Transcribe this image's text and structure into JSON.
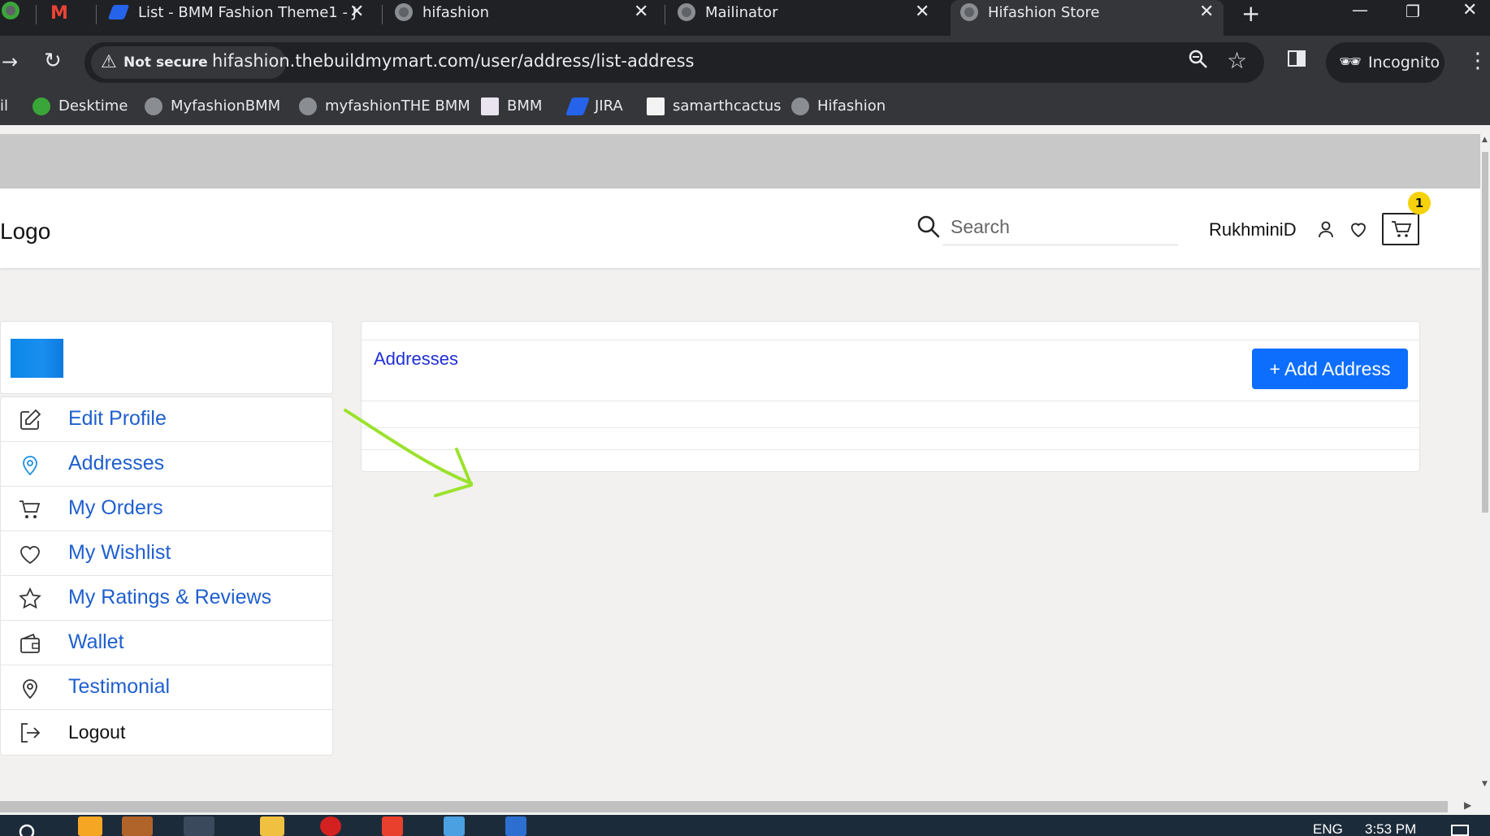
{
  "browser": {
    "tabs": [
      {
        "title": "List - BMM Fashion Theme1 - J",
        "close": "✕",
        "active": false
      },
      {
        "title": "hifashion",
        "close": "✕",
        "active": false
      },
      {
        "title": "Mailinator",
        "close": "✕",
        "active": false
      },
      {
        "title": "Hifashion Store",
        "close": "✕",
        "active": true
      }
    ],
    "new_tab": "+",
    "window_controls": {
      "minimize": "—",
      "restore": "❐",
      "close": "✕"
    },
    "security_label": "Not secure",
    "url": "hifashion.thebuildmymart.com/user/address/list-address",
    "profile_label": "Incognito",
    "bookmarks": [
      "il",
      "Desktime",
      "MyfashionBMM",
      "myfashionTHE BMM",
      "BMM",
      "JIRA",
      "samarthcactus",
      "Hifashion"
    ]
  },
  "header": {
    "logo": "Logo",
    "search_placeholder": "Search",
    "username": "RukhminiD",
    "cart_count": "1"
  },
  "sidebar": {
    "items": [
      {
        "label": "Edit Profile",
        "icon": "edit-icon"
      },
      {
        "label": "Addresses",
        "icon": "location-pin-icon"
      },
      {
        "label": "My Orders",
        "icon": "cart-icon"
      },
      {
        "label": "My Wishlist",
        "icon": "heart-icon"
      },
      {
        "label": "My Ratings & Reviews",
        "icon": "star-icon"
      },
      {
        "label": "Wallet",
        "icon": "wallet-icon"
      },
      {
        "label": "Testimonial",
        "icon": "location-pin-icon"
      },
      {
        "label": "Logout",
        "icon": "logout-icon"
      }
    ]
  },
  "main": {
    "title": "Addresses",
    "add_button": "+ Add Address"
  },
  "taskbar": {
    "language": "ENG",
    "time": "3:53 PM"
  },
  "colors": {
    "accent_blue": "#0d6efd",
    "link_blue": "#1f5fcf",
    "badge_yellow": "#f5d20a",
    "annotation_green": "#9be22d"
  }
}
